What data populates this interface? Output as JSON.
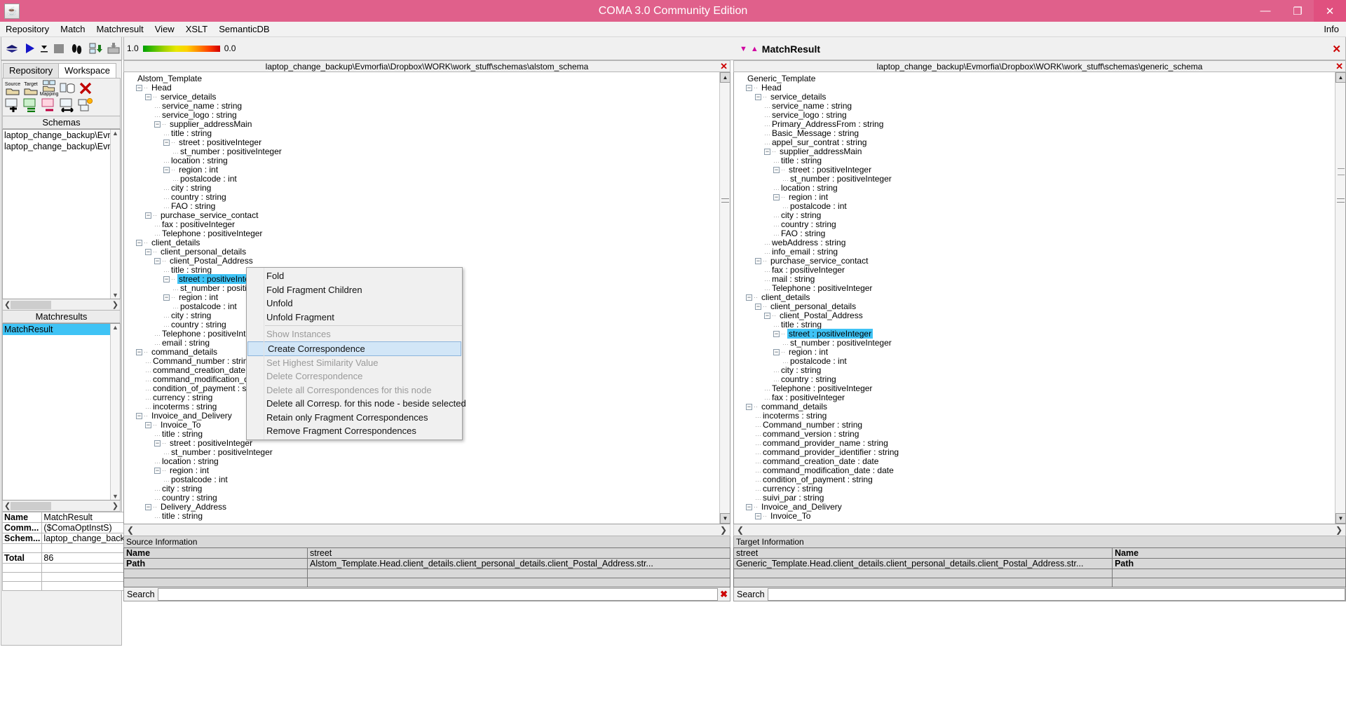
{
  "window": {
    "title": "COMA 3.0 Community Edition",
    "app_icon": "java-coffee-icon",
    "minimize": "—",
    "maximize": "❐",
    "close": "✕"
  },
  "menubar": {
    "items": [
      "Repository",
      "Match",
      "Matchresult",
      "View",
      "XSLT",
      "SemanticDB"
    ],
    "right_label": "Info"
  },
  "toolbar": {
    "icons": [
      {
        "name": "repository-stack-icon",
        "glyph": "☰"
      },
      {
        "name": "run-match-icon",
        "glyph": "▶"
      },
      {
        "name": "run-dropdown-icon",
        "glyph": "▾"
      },
      {
        "name": "stop-icon",
        "glyph": "■"
      },
      {
        "name": "footprints-icon",
        "glyph": "✇"
      },
      {
        "name": "import-schema-icon",
        "glyph": "⤓"
      },
      {
        "name": "export-schema-icon",
        "glyph": "⤒"
      }
    ]
  },
  "similarity_legend": {
    "min_label": "1.0",
    "max_label": "0.0",
    "gradient_from": "#00a000",
    "gradient_to": "#d00000"
  },
  "matchresult_header": {
    "label": "MatchResult",
    "marker_color": "#d000a0",
    "close_glyph": "✕"
  },
  "left_dock": {
    "tabs": [
      {
        "label": "Repository",
        "active": false
      },
      {
        "label": "Workspace",
        "active": true
      }
    ],
    "tool_icons_row1": [
      {
        "name": "source-folder-icon",
        "caption": "Source",
        "glyph": "📁"
      },
      {
        "name": "target-folder-icon",
        "caption": "Target",
        "glyph": "📁"
      },
      {
        "name": "mapping-folder-icon",
        "caption": "Mapping",
        "glyph": "📁"
      },
      {
        "name": "save-to-db-icon",
        "caption": "",
        "glyph": "⛃"
      },
      {
        "name": "delete-red-x-icon",
        "caption": "",
        "glyph": "✖"
      }
    ],
    "tool_icons_row2": [
      {
        "name": "add-matchresult-icon",
        "glyph": "✚"
      },
      {
        "name": "equal-matchresult-icon",
        "glyph": "="
      },
      {
        "name": "subtract-matchresult-icon",
        "glyph": "−"
      },
      {
        "name": "compare-matchresult-icon",
        "glyph": "↔"
      },
      {
        "name": "new-matchresult-icon",
        "glyph": "☀"
      }
    ],
    "schemas_panel": {
      "title": "Schemas",
      "items": [
        "laptop_change_backup\\Evmorfi",
        "laptop_change_backup\\Evmorfi"
      ]
    },
    "matchresults_panel": {
      "title": "Matchresults",
      "items": [
        {
          "label": "MatchResult",
          "selected": true
        }
      ]
    },
    "properties": [
      {
        "key": "Name",
        "value": "MatchResult"
      },
      {
        "key": "Comm...",
        "value": "($ComaOptInstS)"
      },
      {
        "key": "Schem...",
        "value": "laptop_change_back..."
      },
      {
        "key": "",
        "value": ""
      },
      {
        "key": "Total",
        "value": "86"
      },
      {
        "key": "",
        "value": ""
      },
      {
        "key": "",
        "value": ""
      },
      {
        "key": "",
        "value": ""
      }
    ]
  },
  "source_pane": {
    "header_path": "laptop_change_backup\\Evmorfia\\Dropbox\\WORK\\work_stuff\\schemas\\alstom_schema",
    "close_glyph": "✕",
    "tree": [
      {
        "depth": 0,
        "toggle": "none",
        "label": "Alstom_Template"
      },
      {
        "depth": 1,
        "toggle": "minus",
        "label": "Head"
      },
      {
        "depth": 2,
        "toggle": "minus",
        "label": "service_details"
      },
      {
        "depth": 3,
        "toggle": "leaf",
        "label": "service_name : string"
      },
      {
        "depth": 3,
        "toggle": "leaf",
        "label": "service_logo : string"
      },
      {
        "depth": 3,
        "toggle": "minus",
        "label": "supplier_addressMain"
      },
      {
        "depth": 4,
        "toggle": "leaf",
        "label": "title : string"
      },
      {
        "depth": 4,
        "toggle": "minus",
        "label": "street : positiveInteger"
      },
      {
        "depth": 5,
        "toggle": "leaf",
        "label": "st_number : positiveInteger"
      },
      {
        "depth": 4,
        "toggle": "leaf",
        "label": "location : string"
      },
      {
        "depth": 4,
        "toggle": "minus",
        "label": "region : int"
      },
      {
        "depth": 5,
        "toggle": "leaf",
        "label": "postalcode : int"
      },
      {
        "depth": 4,
        "toggle": "leaf",
        "label": "city : string"
      },
      {
        "depth": 4,
        "toggle": "leaf",
        "label": "country : string"
      },
      {
        "depth": 4,
        "toggle": "leaf",
        "label": "FAO : string"
      },
      {
        "depth": 2,
        "toggle": "minus",
        "label": "purchase_service_contact"
      },
      {
        "depth": 3,
        "toggle": "leaf",
        "label": "fax : positiveInteger"
      },
      {
        "depth": 3,
        "toggle": "leaf",
        "label": "Telephone : positiveInteger"
      },
      {
        "depth": 1,
        "toggle": "minus",
        "label": "client_details"
      },
      {
        "depth": 2,
        "toggle": "minus",
        "label": "client_personal_details"
      },
      {
        "depth": 3,
        "toggle": "minus",
        "label": "client_Postal_Address"
      },
      {
        "depth": 4,
        "toggle": "leaf",
        "label": "title : string"
      },
      {
        "depth": 4,
        "toggle": "minus",
        "label": "street : positiveInteger",
        "selected": true
      },
      {
        "depth": 5,
        "toggle": "leaf",
        "label": "st_number : positiveInteger"
      },
      {
        "depth": 4,
        "toggle": "minus",
        "label": "region : int"
      },
      {
        "depth": 5,
        "toggle": "leaf",
        "label": "postalcode : int"
      },
      {
        "depth": 4,
        "toggle": "leaf",
        "label": "city : string"
      },
      {
        "depth": 4,
        "toggle": "leaf",
        "label": "country : string"
      },
      {
        "depth": 3,
        "toggle": "leaf",
        "label": "Telephone : positiveInteger"
      },
      {
        "depth": 3,
        "toggle": "leaf",
        "label": "email : string"
      },
      {
        "depth": 1,
        "toggle": "minus",
        "label": "command_details"
      },
      {
        "depth": 2,
        "toggle": "leaf",
        "label": "Command_number : string"
      },
      {
        "depth": 2,
        "toggle": "leaf",
        "label": "command_creation_date : date"
      },
      {
        "depth": 2,
        "toggle": "leaf",
        "label": "command_modification_date : date"
      },
      {
        "depth": 2,
        "toggle": "leaf",
        "label": "condition_of_payment : string"
      },
      {
        "depth": 2,
        "toggle": "leaf",
        "label": "currency : string"
      },
      {
        "depth": 2,
        "toggle": "leaf",
        "label": "incoterms : string"
      },
      {
        "depth": 1,
        "toggle": "minus",
        "label": "Invoice_and_Delivery"
      },
      {
        "depth": 2,
        "toggle": "minus",
        "label": "Invoice_To"
      },
      {
        "depth": 3,
        "toggle": "leaf",
        "label": "title : string"
      },
      {
        "depth": 3,
        "toggle": "minus",
        "label": "street : positiveInteger"
      },
      {
        "depth": 4,
        "toggle": "leaf",
        "label": "st_number : positiveInteger"
      },
      {
        "depth": 3,
        "toggle": "leaf",
        "label": "location : string"
      },
      {
        "depth": 3,
        "toggle": "minus",
        "label": "region : int"
      },
      {
        "depth": 4,
        "toggle": "leaf",
        "label": "postalcode : int"
      },
      {
        "depth": 3,
        "toggle": "leaf",
        "label": "city : string"
      },
      {
        "depth": 3,
        "toggle": "leaf",
        "label": "country : string"
      },
      {
        "depth": 2,
        "toggle": "minus",
        "label": "Delivery_Address"
      },
      {
        "depth": 3,
        "toggle": "leaf",
        "label": "title : string"
      }
    ],
    "info": {
      "title": "Source Information",
      "rows": [
        {
          "key": "Name",
          "value": "street"
        },
        {
          "key": "Path",
          "value": "Alstom_Template.Head.client_details.client_personal_details.client_Postal_Address.str..."
        },
        {
          "key": "",
          "value": ""
        },
        {
          "key": "",
          "value": ""
        }
      ]
    },
    "search": {
      "label": "Search",
      "value": "",
      "placeholder": "",
      "clear_glyph": "✖"
    }
  },
  "target_pane": {
    "header_path": "laptop_change_backup\\Evmorfia\\Dropbox\\WORK\\work_stuff\\schemas\\generic_schema",
    "close_glyph": "✕",
    "tree": [
      {
        "depth": 0,
        "toggle": "none",
        "label": "Generic_Template"
      },
      {
        "depth": 1,
        "toggle": "minus",
        "label": "Head"
      },
      {
        "depth": 2,
        "toggle": "minus",
        "label": "service_details"
      },
      {
        "depth": 3,
        "toggle": "leaf",
        "label": "service_name : string"
      },
      {
        "depth": 3,
        "toggle": "leaf",
        "label": "service_logo : string"
      },
      {
        "depth": 3,
        "toggle": "leaf",
        "label": "Primary_AddressFrom : string"
      },
      {
        "depth": 3,
        "toggle": "leaf",
        "label": "Basic_Message : string"
      },
      {
        "depth": 3,
        "toggle": "leaf",
        "label": "appel_sur_contrat : string"
      },
      {
        "depth": 3,
        "toggle": "minus",
        "label": "supplier_addressMain"
      },
      {
        "depth": 4,
        "toggle": "leaf",
        "label": "title : string"
      },
      {
        "depth": 4,
        "toggle": "minus",
        "label": "street : positiveInteger"
      },
      {
        "depth": 5,
        "toggle": "leaf",
        "label": "st_number : positiveInteger"
      },
      {
        "depth": 4,
        "toggle": "leaf",
        "label": "location : string"
      },
      {
        "depth": 4,
        "toggle": "minus",
        "label": "region : int"
      },
      {
        "depth": 5,
        "toggle": "leaf",
        "label": "postalcode : int"
      },
      {
        "depth": 4,
        "toggle": "leaf",
        "label": "city : string"
      },
      {
        "depth": 4,
        "toggle": "leaf",
        "label": "country : string"
      },
      {
        "depth": 4,
        "toggle": "leaf",
        "label": "FAO : string"
      },
      {
        "depth": 3,
        "toggle": "leaf",
        "label": "webAddress : string"
      },
      {
        "depth": 3,
        "toggle": "leaf",
        "label": "info_email : string"
      },
      {
        "depth": 2,
        "toggle": "minus",
        "label": "purchase_service_contact"
      },
      {
        "depth": 3,
        "toggle": "leaf",
        "label": "fax : positiveInteger"
      },
      {
        "depth": 3,
        "toggle": "leaf",
        "label": "mail : string"
      },
      {
        "depth": 3,
        "toggle": "leaf",
        "label": "Telephone : positiveInteger"
      },
      {
        "depth": 1,
        "toggle": "minus",
        "label": "client_details"
      },
      {
        "depth": 2,
        "toggle": "minus",
        "label": "client_personal_details"
      },
      {
        "depth": 3,
        "toggle": "minus",
        "label": "client_Postal_Address"
      },
      {
        "depth": 4,
        "toggle": "leaf",
        "label": "title : string"
      },
      {
        "depth": 4,
        "toggle": "minus",
        "label": "street : positiveInteger",
        "selected": true
      },
      {
        "depth": 5,
        "toggle": "leaf",
        "label": "st_number : positiveInteger"
      },
      {
        "depth": 4,
        "toggle": "minus",
        "label": "region : int"
      },
      {
        "depth": 5,
        "toggle": "leaf",
        "label": "postalcode : int"
      },
      {
        "depth": 4,
        "toggle": "leaf",
        "label": "city : string"
      },
      {
        "depth": 4,
        "toggle": "leaf",
        "label": "country : string"
      },
      {
        "depth": 3,
        "toggle": "leaf",
        "label": "Telephone : positiveInteger"
      },
      {
        "depth": 3,
        "toggle": "leaf",
        "label": "fax : positiveInteger"
      },
      {
        "depth": 1,
        "toggle": "minus",
        "label": "command_details"
      },
      {
        "depth": 2,
        "toggle": "leaf",
        "label": "incoterms : string"
      },
      {
        "depth": 2,
        "toggle": "leaf",
        "label": "Command_number : string"
      },
      {
        "depth": 2,
        "toggle": "leaf",
        "label": "command_version : string"
      },
      {
        "depth": 2,
        "toggle": "leaf",
        "label": "command_provider_name : string"
      },
      {
        "depth": 2,
        "toggle": "leaf",
        "label": "command_provider_identifier : string"
      },
      {
        "depth": 2,
        "toggle": "leaf",
        "label": "command_creation_date : date"
      },
      {
        "depth": 2,
        "toggle": "leaf",
        "label": "command_modification_date : date"
      },
      {
        "depth": 2,
        "toggle": "leaf",
        "label": "condition_of_payment : string"
      },
      {
        "depth": 2,
        "toggle": "leaf",
        "label": "currency : string"
      },
      {
        "depth": 2,
        "toggle": "leaf",
        "label": "suivi_par : string"
      },
      {
        "depth": 1,
        "toggle": "minus",
        "label": "Invoice_and_Delivery"
      },
      {
        "depth": 2,
        "toggle": "minus",
        "label": "Invoice_To"
      }
    ],
    "info": {
      "title": "Target Information",
      "rows": [
        {
          "key": "street",
          "value": "Name"
        },
        {
          "key": "Generic_Template.Head.client_details.client_personal_details.client_Postal_Address.str...",
          "value": "Path"
        },
        {
          "key": "",
          "value": ""
        },
        {
          "key": "",
          "value": ""
        }
      ]
    },
    "search": {
      "label": "Search",
      "value": "",
      "placeholder": ""
    }
  },
  "context_menu": {
    "items": [
      {
        "label": "Fold",
        "state": "normal"
      },
      {
        "label": "Fold Fragment Children",
        "state": "normal"
      },
      {
        "label": "Unfold",
        "state": "normal"
      },
      {
        "label": "Unfold Fragment",
        "state": "normal"
      },
      {
        "label": "__sep__",
        "state": "separator"
      },
      {
        "label": "Show Instances",
        "state": "disabled"
      },
      {
        "label": "Create Correspondence",
        "state": "highlighted"
      },
      {
        "label": "Set Highest Similarity Value",
        "state": "disabled"
      },
      {
        "label": "Delete Correspondence",
        "state": "disabled"
      },
      {
        "label": "Delete all Correspondences for this node",
        "state": "disabled"
      },
      {
        "label": "Delete all Corresp. for this node - beside selected",
        "state": "normal"
      },
      {
        "label": "Retain only Fragment Correspondences",
        "state": "normal"
      },
      {
        "label": "Remove Fragment Correspondences",
        "state": "normal"
      }
    ]
  }
}
